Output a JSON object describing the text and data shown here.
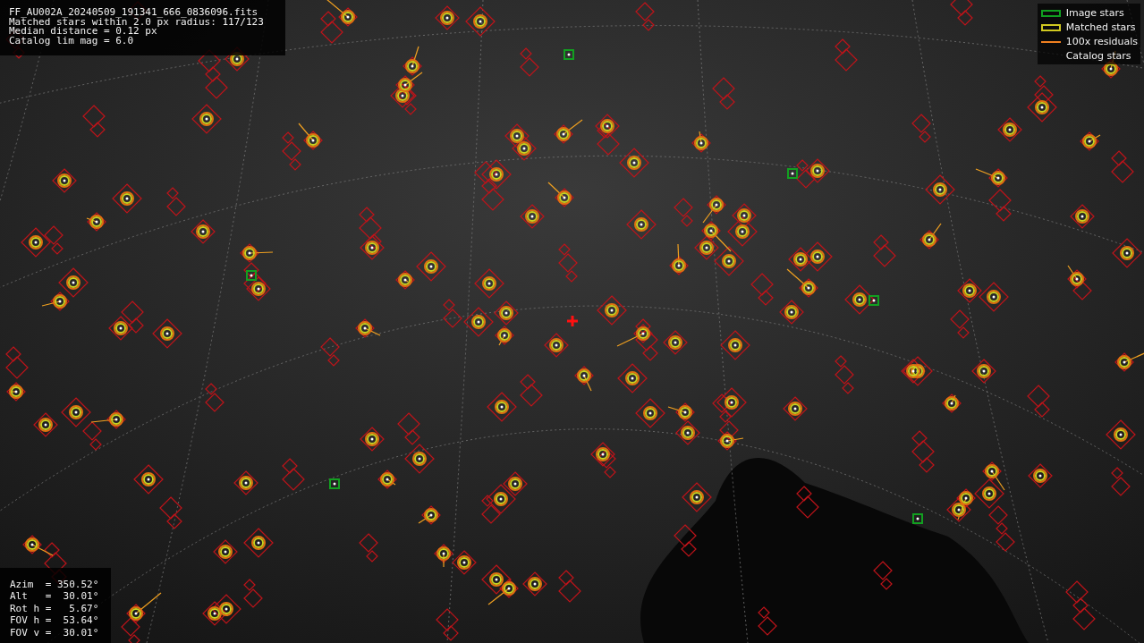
{
  "info_lines": [
    "FF_AU002A_20240509_191341_666_0836096.fits",
    "Matched stars within 2.0 px radius: 117/123",
    "Median distance = 0.12 px",
    "Catalog lim mag = 6.0"
  ],
  "legend": [
    {
      "kind": "image",
      "label": "Image stars"
    },
    {
      "kind": "matched",
      "label": "Matched stars"
    },
    {
      "kind": "residual",
      "label": "100x residuals"
    },
    {
      "kind": "catalog",
      "label": "Catalog stars"
    }
  ],
  "pointing_lines": [
    "Azim  = 350.52°",
    "Alt   =  30.01°",
    "Rot h =   5.67°",
    "FOV h =  53.64°",
    "FOV v =  30.01°"
  ]
}
